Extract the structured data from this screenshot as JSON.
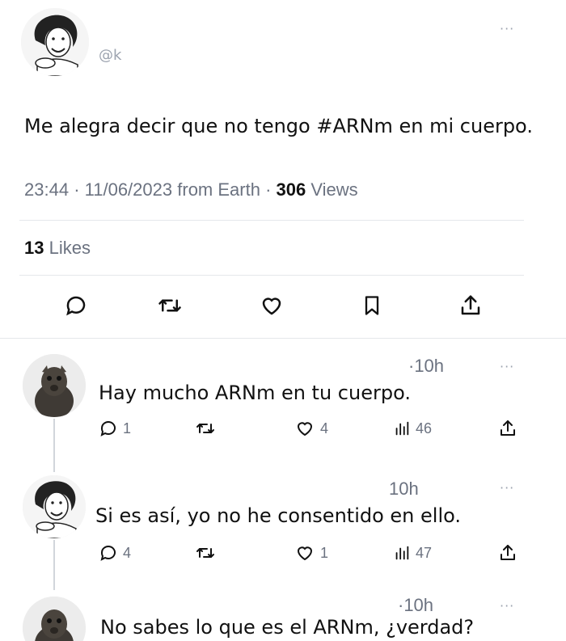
{
  "tweet": {
    "handle": "@k",
    "text": "Me alegra decir que no tengo #ARNm en mi cuerpo.",
    "time": "23:44",
    "date": "11/06/2023",
    "source": "from Earth",
    "views_count": "306",
    "views_label": "Views",
    "likes_count": "13",
    "likes_label": "Likes",
    "more": "···"
  },
  "replies": [
    {
      "time": "·10h",
      "text": "Hay mucho ARNm en tu cuerpo.",
      "replies": "1",
      "likes": "4",
      "views": "46",
      "more": "···"
    },
    {
      "time": "10h",
      "text": "Si es así, yo no he consentido en ello.",
      "replies": "4",
      "likes": "1",
      "views": "47",
      "more": "···"
    },
    {
      "time": "·10h",
      "text": "No sabes lo que es el ARNm, ¿verdad?",
      "more": "···"
    }
  ],
  "icons": [
    "reply-icon",
    "retweet-icon",
    "like-icon",
    "bookmark-icon",
    "share-icon",
    "views-icon"
  ]
}
